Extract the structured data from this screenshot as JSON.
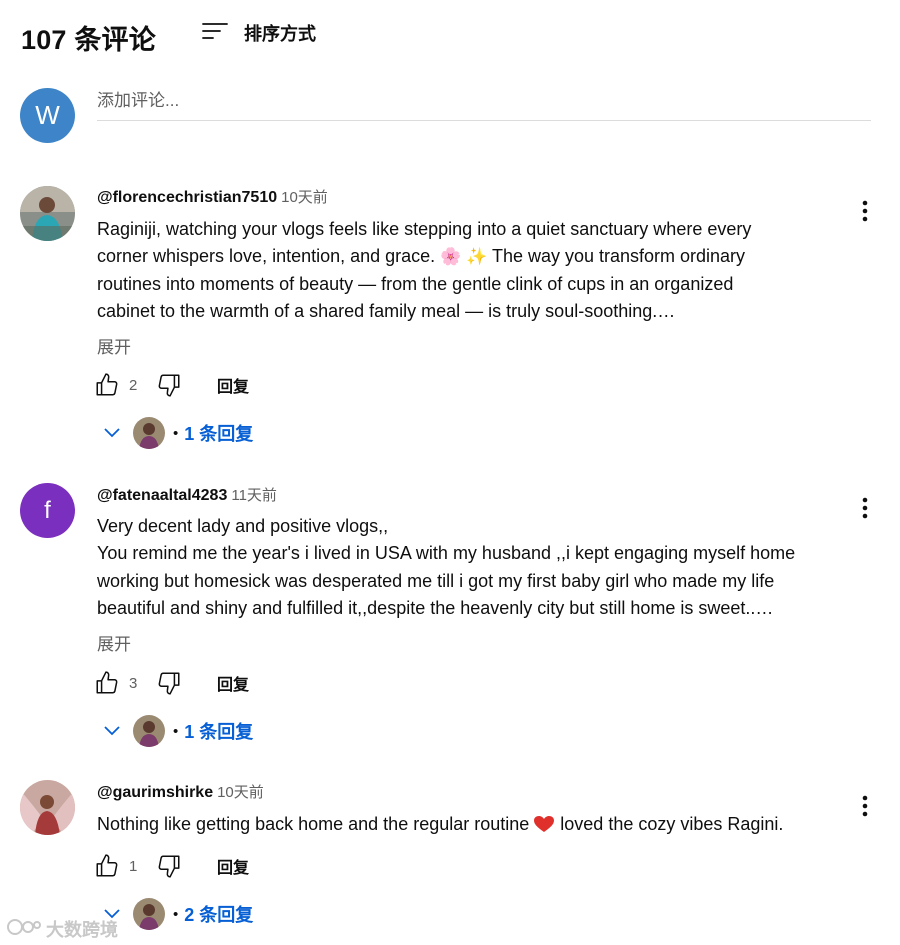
{
  "header": {
    "title": "107 条评论",
    "sort_label": "排序方式"
  },
  "add_comment": {
    "avatar_letter": "W",
    "placeholder": "添加评论...",
    "avatar_color": "#3d85c8"
  },
  "comments": [
    {
      "author": "@florencechristian7510",
      "time": "10天前",
      "lines": [
        "Raginiji, watching your vlogs feels like stepping into a quiet sanctuary where every",
        "corner whispers love, intention, and grace.",
        "The way you transform ordinary",
        "routines into moments of beauty — from the gentle clink of cups in an organized",
        "cabinet to the warmth of a shared family meal — is truly soul-soothing.…"
      ],
      "emoji": "🌸 ✨",
      "expand": "展开",
      "likes": "2",
      "reply": "回复",
      "replies": "1 条回复"
    },
    {
      "author": "@fatenaaltal4283",
      "time": "11天前",
      "avatar_letter": "f",
      "avatar_color": "#7b2fbe",
      "lines": [
        "Very decent lady and positive vlogs,,",
        "You remind me the year's i lived in USA  with my husband ,,i kept engaging myself home",
        "working but homesick was desperated me till i got my first baby girl who made my life",
        "beautiful and shiny and fulfilled it,,despite the heavenly city but still home is sweet..…"
      ],
      "expand": "展开",
      "likes": "3",
      "reply": "回复",
      "replies": "1 条回复"
    },
    {
      "author": "@gaurimshirke",
      "time": "10天前",
      "line_before": "Nothing like getting back home and the regular routine",
      "line_after": " loved the cozy vibes Ragini.",
      "likes": "1",
      "reply": "回复",
      "replies": "2 条回复"
    }
  ],
  "icons": [
    "sort-icon",
    "like-icon",
    "dislike-icon",
    "chevron-down-icon",
    "more-vert-icon",
    "heart-icon"
  ],
  "watermark": "大数跨境",
  "accent_color": "#065fd4"
}
